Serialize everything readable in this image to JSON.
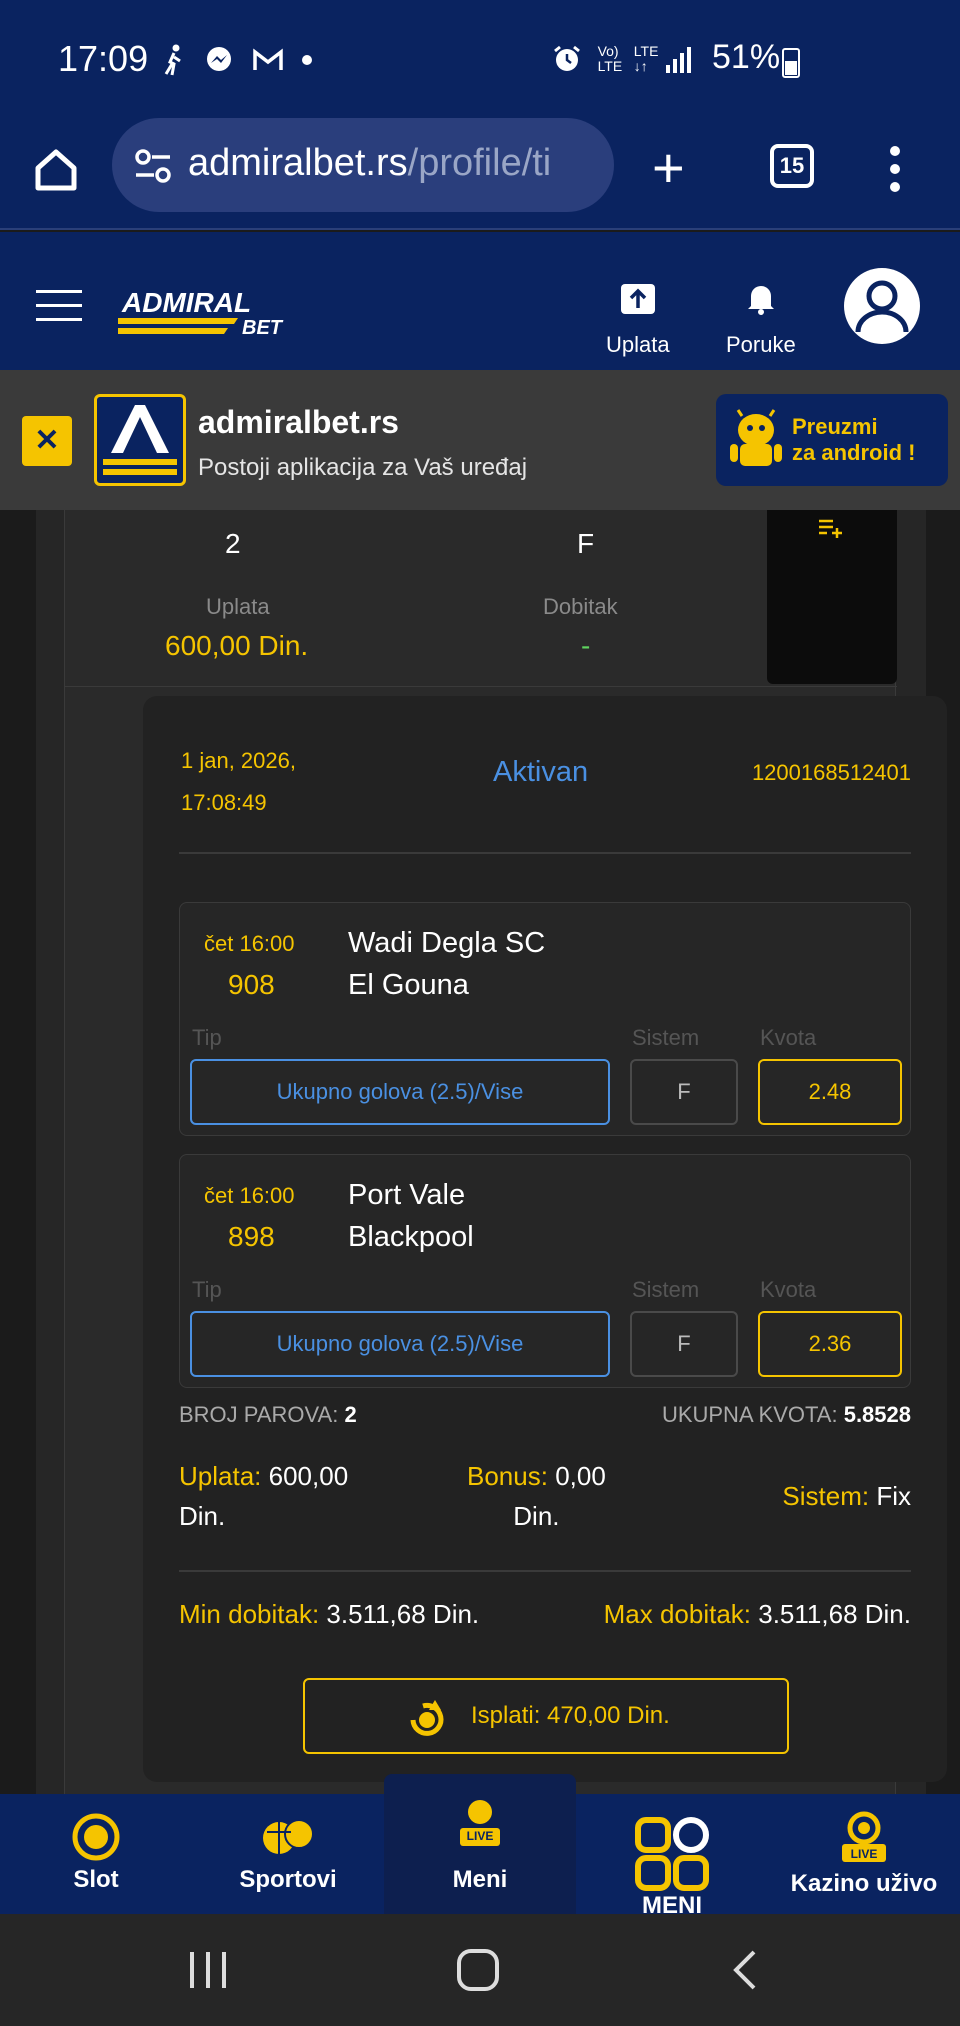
{
  "status_bar": {
    "time": "17:09",
    "battery": "51%",
    "left_icons": [
      "walk-icon",
      "messenger-icon",
      "gmail-icon",
      "dot-icon"
    ],
    "right_icons": [
      "alarm-icon",
      "volte-icon",
      "lte-icon",
      "signal-icon",
      "battery-icon"
    ]
  },
  "browser": {
    "url_domain": "admiralbet.rs",
    "url_path": "/profile/ti",
    "tab_count": "15"
  },
  "header": {
    "logo_text": "ADMIRAL BET",
    "deposit_label": "Uplata",
    "messages_label": "Poruke"
  },
  "app_banner": {
    "close_label": "✕",
    "title": "admiralbet.rs",
    "subtitle": "Postoji aplikacija za Vaš uređaj",
    "cta_line1": "Preuzmi",
    "cta_line2": "za android !"
  },
  "previous_ticket": {
    "col1_value": "2",
    "col2_value": "F",
    "deposit_label": "Uplata",
    "deposit_value": "600,00 Din.",
    "win_label": "Dobitak",
    "win_value": "-"
  },
  "ticket": {
    "date_line1": "1 jan, 2026,",
    "date_line2": "17:08:49",
    "status": "Aktivan",
    "id": "1200168512401",
    "matches": [
      {
        "time": "čet 16:00",
        "code": "908",
        "team1": "Wadi Degla SC",
        "team2": "El Gouna",
        "tip_header": "Tip",
        "system_header": "Sistem",
        "odds_header": "Kvota",
        "tip": "Ukupno golova (2.5)/Vise",
        "system": "F",
        "odds": "2.48"
      },
      {
        "time": "čet 16:00",
        "code": "898",
        "team1": "Port Vale",
        "team2": "Blackpool",
        "tip_header": "Tip",
        "system_header": "Sistem",
        "odds_header": "Kvota",
        "tip": "Ukupno golova (2.5)/Vise",
        "system": "F",
        "odds": "2.36"
      }
    ],
    "pairs_label": "BROJ PAROVA:",
    "pairs_value": "2",
    "total_odds_label": "UKUPNA KVOTA:",
    "total_odds_value": "5.8528",
    "stake_label": "Uplata:",
    "stake_value_line1": "600,00",
    "stake_value_line2": "Din.",
    "bonus_label": "Bonus:",
    "bonus_value_line1": "0,00",
    "bonus_value_line2": "Din.",
    "system_label": "Sistem:",
    "system_value": "Fix",
    "min_win_label": "Min dobitak:",
    "min_win_value": "3.511,68 Din.",
    "max_win_label": "Max dobitak:",
    "max_win_value": "3.511,68 Din.",
    "payout_label": "Isplati: 470,00 Din."
  },
  "bottom_nav": {
    "items": [
      {
        "label": "Slot",
        "icon": "slot-icon"
      },
      {
        "label": "Sportovi",
        "icon": "sports-icon"
      },
      {
        "label": "Meni",
        "icon": "live-ball-icon"
      },
      {
        "label": "MENI",
        "icon": "grid-icon"
      },
      {
        "label": "Kazino uživo",
        "icon": "live-casino-icon"
      }
    ],
    "live_badge": "LIVE"
  },
  "colors": {
    "brand_blue": "#0a2360",
    "accent_yellow": "#f5c400",
    "status_blue": "#4a90e2",
    "win_green": "#5fd35f"
  }
}
